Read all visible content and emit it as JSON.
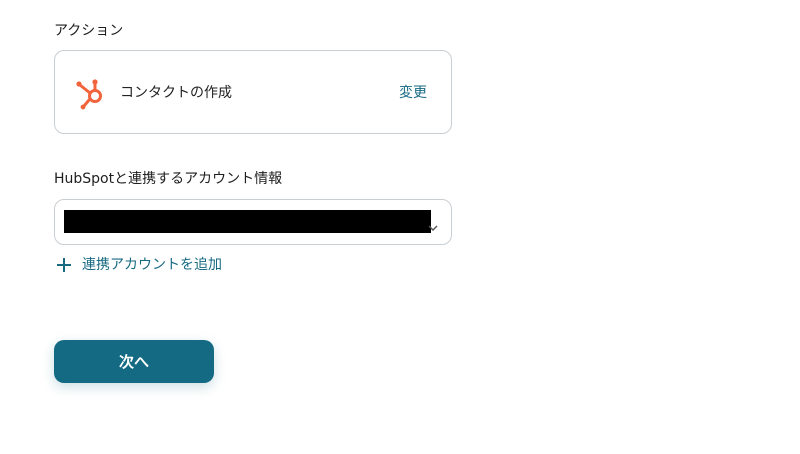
{
  "action_section": {
    "label": "アクション",
    "action_name": "コンタクトの作成",
    "change_label": "変更",
    "app_icon": "hubspot-logo-icon",
    "app_icon_color": "#f2643b"
  },
  "account_section": {
    "label": "HubSpotと連携するアカウント情報",
    "selected_value": "",
    "chevron_icon": "chevron-down-icon",
    "add_account_label": "連携アカウントを追加",
    "add_icon": "plus-icon"
  },
  "footer": {
    "next_label": "次へ"
  },
  "colors": {
    "accent": "#136a82",
    "link": "#176a82",
    "border": "#c9ced3"
  }
}
